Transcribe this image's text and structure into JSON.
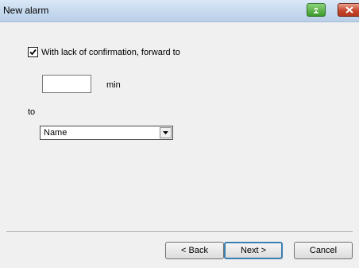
{
  "window": {
    "title": "New alarm",
    "help_icon": "help-icon",
    "close_icon": "close-icon"
  },
  "forward": {
    "checkbox_checked": true,
    "checkbox_label": "With lack of confirmation, forward to",
    "minutes_value": "",
    "minutes_unit": "min",
    "to_label": "to",
    "recipient_selected": "Name"
  },
  "buttons": {
    "back": "< Back",
    "next": "Next >",
    "cancel": "Cancel"
  }
}
